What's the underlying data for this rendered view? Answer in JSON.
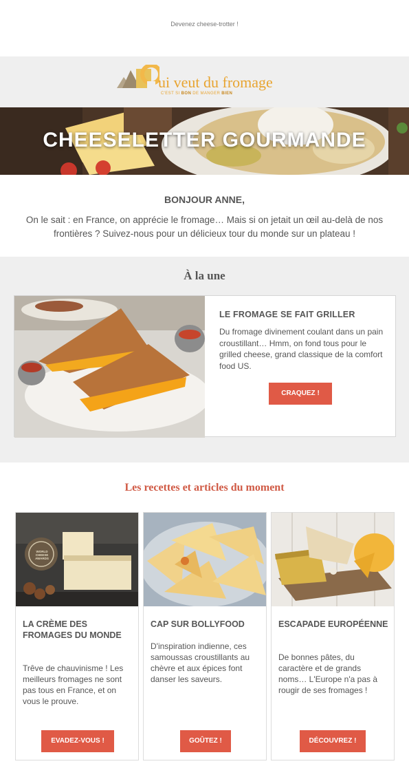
{
  "preheader": "Devenez cheese-trotter !",
  "logo": {
    "title": "ui veut du fromage",
    "tagline_prefix": "C'EST SI ",
    "tagline_bon": "BON",
    "tagline_middle": " DE MANGER ",
    "tagline_bien": "BIEN"
  },
  "hero": {
    "title": "CHEESELETTER GOURMANDE"
  },
  "greeting": "BONJOUR ANNE,",
  "intro": "On le sait : en France, on apprécie le fromage… Mais si on jetait un œil au-delà de nos frontières ? Suivez-nous pour un délicieux tour du monde sur un plateau !",
  "une": {
    "title": "À la une",
    "article": {
      "heading": "LE FROMAGE SE FAIT GRILLER",
      "text": "Du fromage divinement coulant dans un pain croustillant… Hmm, on fond tous pour le grilled cheese, grand classique de la comfort food US.",
      "button": "CRAQUEZ !"
    }
  },
  "recettes": {
    "title": "Les recettes et articles du moment",
    "cards": [
      {
        "heading": "LA CRÈME DES FROMAGES DU MONDE",
        "text": "Trêve de chauvinisme ! Les meilleurs fromages ne sont pas tous en France, et on vous le prouve.",
        "button": "EVADEZ-VOUS !",
        "image_badge": "WORLD CHEESE AWARDS"
      },
      {
        "heading": "CAP SUR BOLLYFOOD",
        "text": "D'inspiration indienne, ces samoussas croustillants au chèvre et aux épices font danser les saveurs.",
        "button": "GOÛTEZ !"
      },
      {
        "heading": "ESCAPADE EUROPÉENNE",
        "text": "De bonnes pâtes, du caractère et de grands noms… L'Europe n'a pas à rougir de ses fromages !",
        "button": "DÉCOUVREZ !"
      }
    ]
  },
  "colors": {
    "accent": "#e05a46",
    "section_title": "#d05a45",
    "logo": "#e8a430",
    "band": "#efefef"
  }
}
